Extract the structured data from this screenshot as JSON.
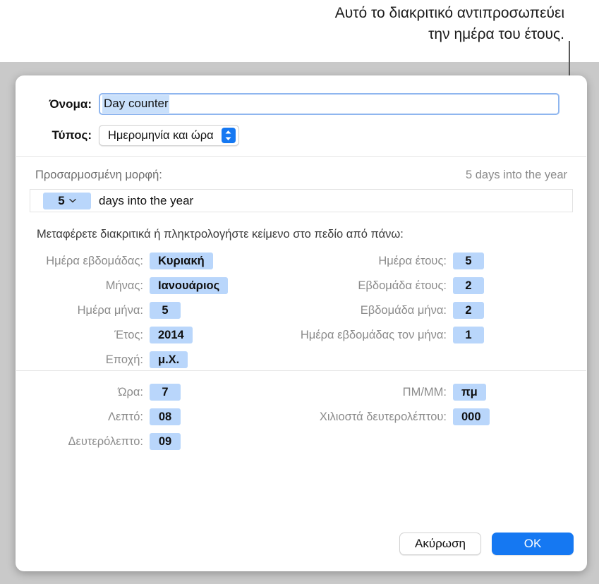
{
  "callout": {
    "line1": "Αυτό το διακριτικό αντιπροσωπεύει",
    "line2": "την ημέρα του έτους."
  },
  "dialog": {
    "name_field": {
      "label": "Όνομα:",
      "value": "Day counter"
    },
    "type_field": {
      "label": "Τύπος:",
      "value": "Ημερομηνία και ώρα",
      "chevron_icon": "chevron-up-down-icon"
    },
    "custom_format": {
      "label": "Προσαρμοσμένη μορφή:",
      "preview": "5 days into the year",
      "token_value": "5",
      "token_chevron_icon": "chevron-down-icon",
      "trailing_text": "days into the year"
    },
    "instructions": "Μεταφέρετε διακριτικά ή πληκτρολογήστε κείμενο στο πεδίο από πάνω:",
    "date_tokens_left": [
      {
        "label": "Ημέρα εβδομάδας:",
        "value": "Κυριακή"
      },
      {
        "label": "Μήνας:",
        "value": "Ιανουάριος"
      },
      {
        "label": "Ημέρα μήνα:",
        "value": "5"
      },
      {
        "label": "Έτος:",
        "value": "2014"
      },
      {
        "label": "Εποχή:",
        "value": "μ.Χ."
      }
    ],
    "date_tokens_right": [
      {
        "label": "Ημέρα έτους:",
        "value": "5"
      },
      {
        "label": "Εβδομάδα έτους:",
        "value": "2"
      },
      {
        "label": "Εβδομάδα μήνα:",
        "value": "2"
      },
      {
        "label": "Ημέρα εβδομάδας τον μήνα:",
        "value": "1"
      }
    ],
    "time_tokens_left": [
      {
        "label": "Ώρα:",
        "value": "7"
      },
      {
        "label": "Λεπτό:",
        "value": "08"
      },
      {
        "label": "Δευτερόλεπτο:",
        "value": "09"
      }
    ],
    "time_tokens_right": [
      {
        "label": "ΠΜ/ΜΜ:",
        "value": "πμ"
      },
      {
        "label": "Χιλιοστά δευτερολέπτου:",
        "value": "000"
      }
    ],
    "buttons": {
      "cancel": "Ακύρωση",
      "ok": "OK"
    }
  },
  "colors": {
    "accent_blue": "#1578f2",
    "token_blue": "#b9d6fb",
    "selection_blue": "#c9e0fb",
    "focus_ring": "#8fb6ef",
    "backdrop_gray": "#c9c9c9",
    "label_gray": "#8b8b8b",
    "callout_line": "#595959"
  }
}
